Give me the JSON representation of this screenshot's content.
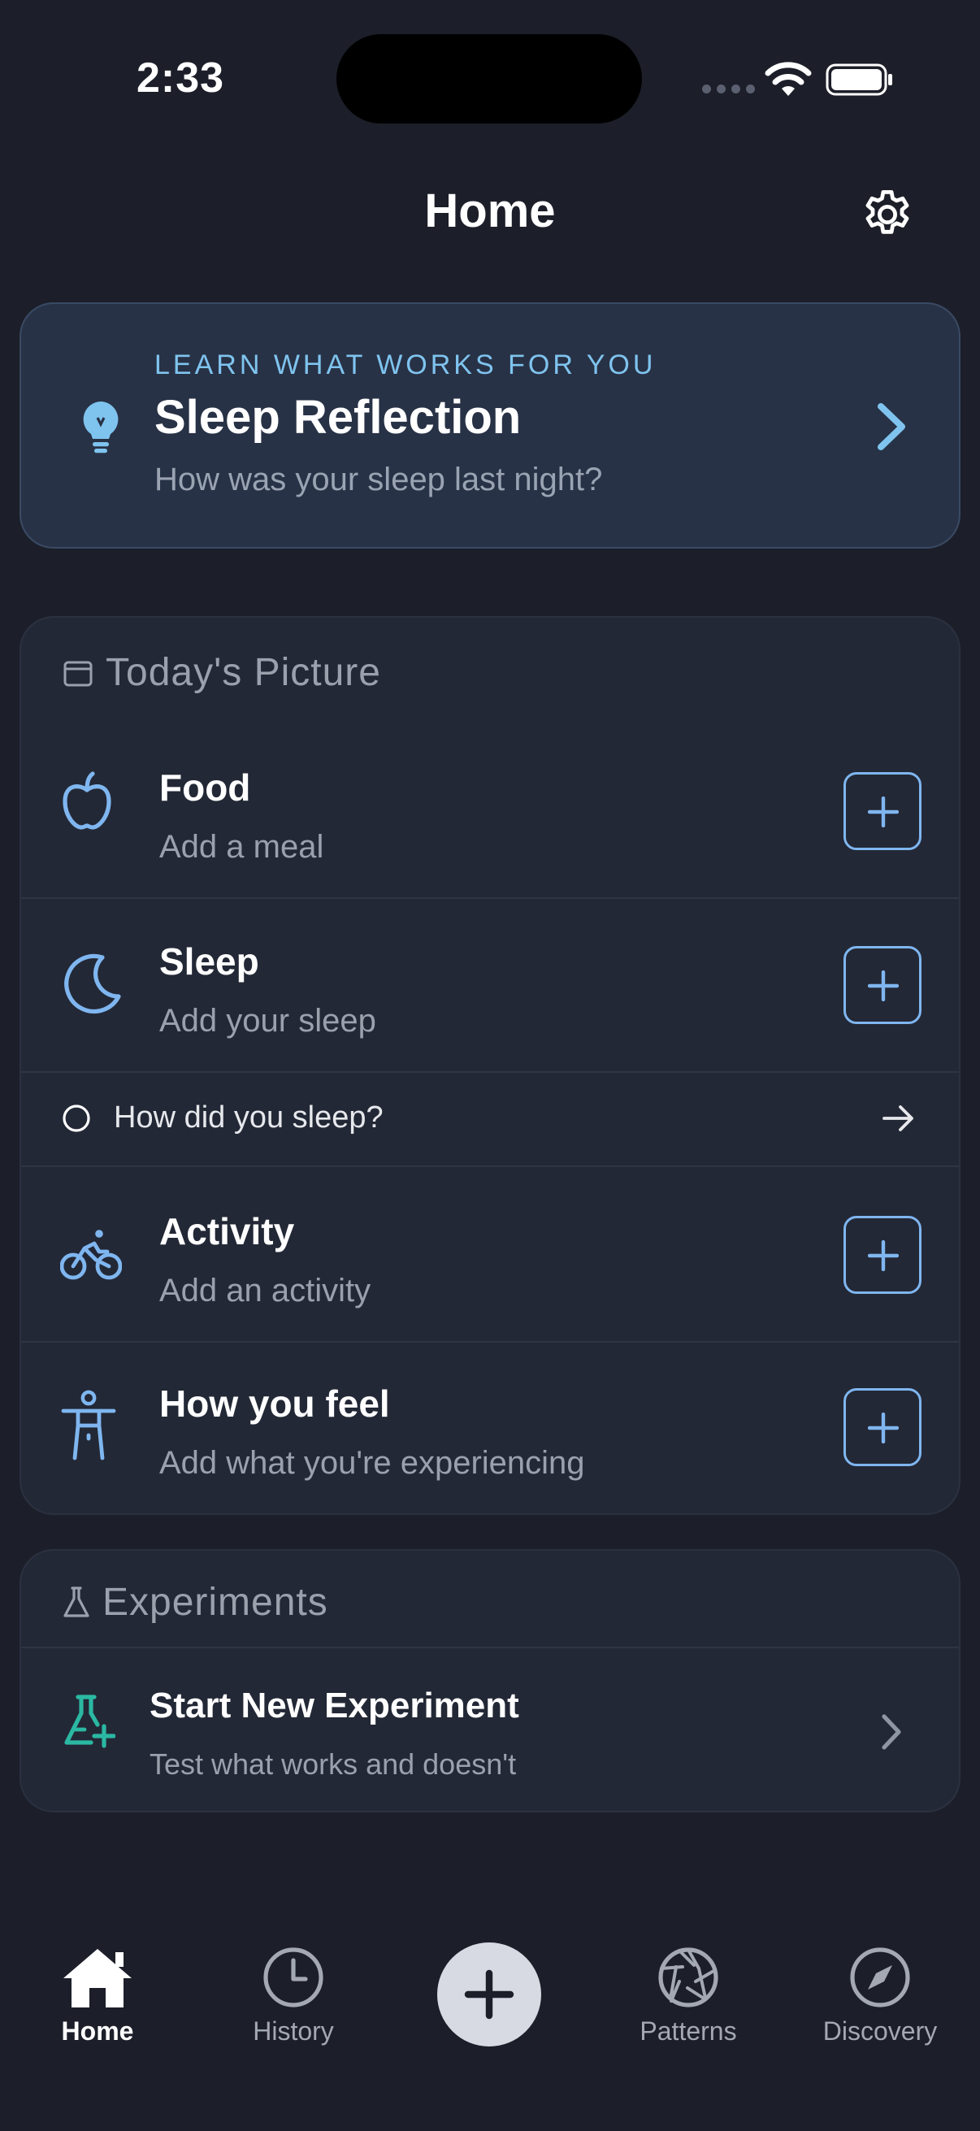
{
  "status_bar": {
    "time": "2:33"
  },
  "header": {
    "title": "Home"
  },
  "banner": {
    "eyebrow": "LEARN WHAT WORKS FOR YOU",
    "title": "Sleep Reflection",
    "subtitle": "How was your sleep last night?"
  },
  "today": {
    "title": "Today's Picture",
    "items": [
      {
        "icon": "apple-icon",
        "title": "Food",
        "subtitle": "Add a meal"
      },
      {
        "icon": "moon-icon",
        "title": "Sleep",
        "subtitle": "Add your sleep"
      },
      {
        "icon": "bicycle-icon",
        "title": "Activity",
        "subtitle": "Add an activity"
      },
      {
        "icon": "person-icon",
        "title": "How you feel",
        "subtitle": "Add what you're experiencing"
      }
    ],
    "sleep_prompt": "How did you sleep?"
  },
  "experiments": {
    "title": "Experiments",
    "item": {
      "title": "Start New Experiment",
      "subtitle": "Test what works and doesn't"
    }
  },
  "tabbar": {
    "home": "Home",
    "history": "History",
    "patterns": "Patterns",
    "discovery": "Discovery",
    "active": "home"
  },
  "colors": {
    "background": "#1c1f29",
    "card": "#232836",
    "banner": "#283246",
    "accent_blue": "#7fb6f0",
    "accent_teal": "#2bb8a3",
    "eyebrow": "#7fc4ef"
  }
}
